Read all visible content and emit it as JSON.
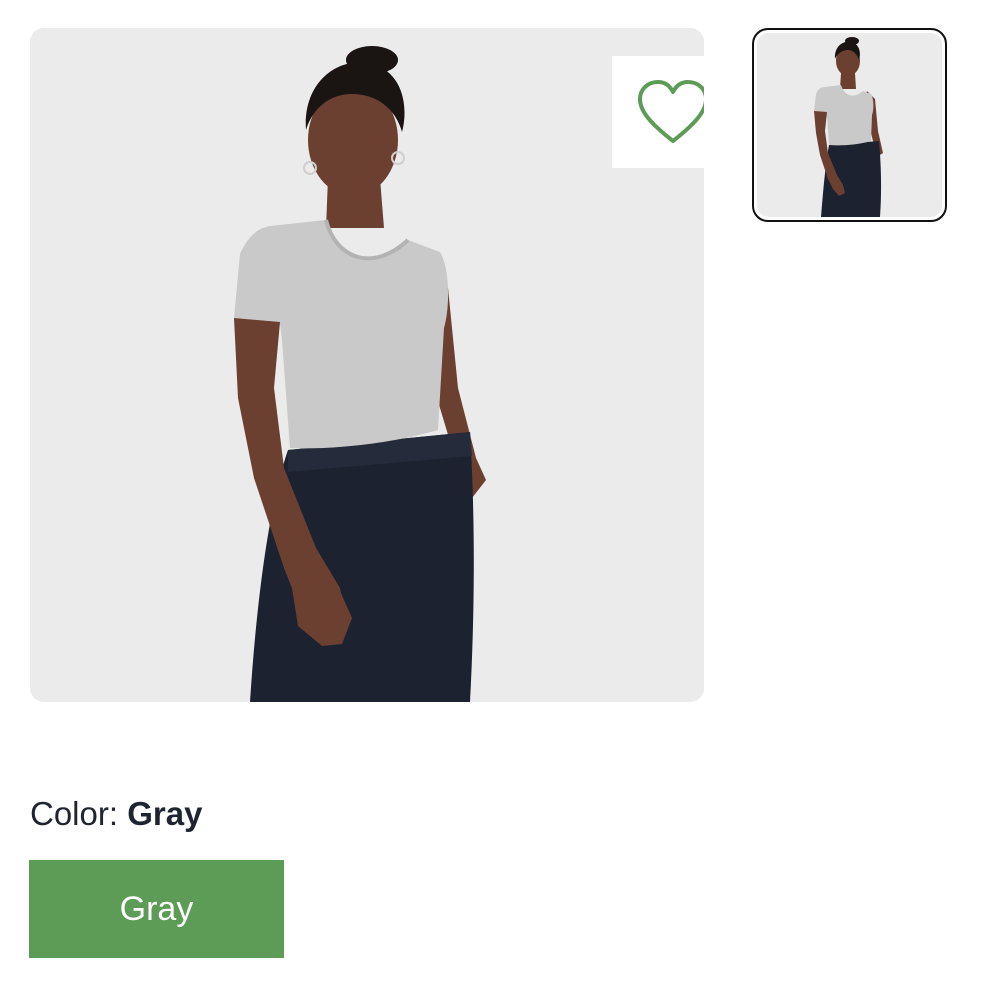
{
  "product": {
    "main_image_alt": "Woman wearing a gray ribbed square-neck cropped t-shirt and a black long skirt",
    "thumbnail_alt": "Thumbnail: gray square-neck cropped t-shirt",
    "wishlist_icon": "heart-outline-icon"
  },
  "variant": {
    "label": "Color:",
    "selected_value": "Gray",
    "options": [
      "Gray"
    ]
  },
  "colors": {
    "accent": "#5c9c57",
    "image_background": "#ebebeb",
    "thumb_border": "#111111",
    "text": "#1f2431"
  }
}
